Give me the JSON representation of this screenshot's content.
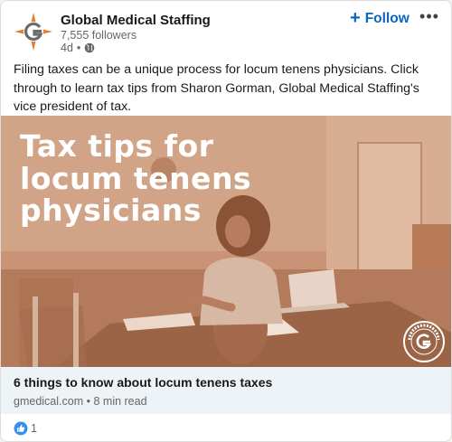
{
  "company": {
    "name": "Global Medical Staffing",
    "followers": "7,555 followers",
    "age": "4d",
    "separator": "•",
    "logo_icon": "gms-compass-logo-icon",
    "visibility_icon": "globe-icon"
  },
  "actions": {
    "follow_icon": "plus-icon",
    "follow_plus": "+",
    "follow_label": "Follow",
    "more_icon": "more-options-icon",
    "more_label": "•••"
  },
  "post": {
    "text": "Filing taxes can be a unique process for locum tenens physicians. Click through to learn tax tips from Sharon Gorman, Global Medical Staffing's vice president of tax."
  },
  "hero": {
    "lines": [
      "Tax tips for",
      "locum tenens",
      "physicians"
    ],
    "badge_icon": "global-medical-staffing-badge-icon"
  },
  "link": {
    "title": "6 things to know about locum tenens taxes",
    "domain": "gmedical.com",
    "separator": "•",
    "read_time": "8 min read"
  },
  "reactions": {
    "icon": "like-icon",
    "count": "1"
  },
  "colors": {
    "accent": "#0a66c2",
    "brand_orange": "#e8702a",
    "hero_tint": "#c89275",
    "link_bg": "#eef3f8"
  }
}
